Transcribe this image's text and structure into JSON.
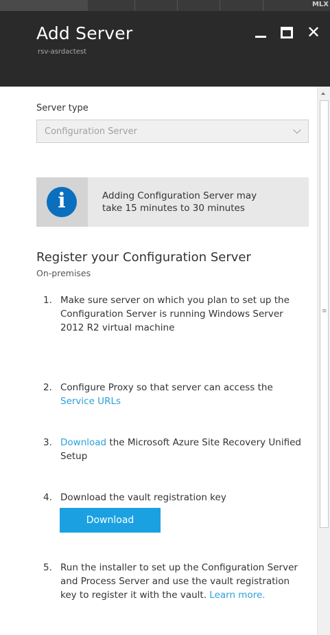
{
  "top_strip": {
    "right_text": "MLX"
  },
  "header": {
    "title": "Add Server",
    "subtitle": "rsv-asrdactest"
  },
  "form": {
    "server_type_label": "Server type",
    "server_type_value": "Configuration Server"
  },
  "info": {
    "message_line1": "Adding Configuration Server may",
    "message_line2": "take 15 minutes to 30 minutes"
  },
  "section": {
    "title": "Register your Configuration Server",
    "subtitle": "On-premises"
  },
  "steps": [
    {
      "num": "1.",
      "text": "Make sure server on which you plan to set up the Configuration Server is running Windows Server 2012 R2 virtual machine"
    },
    {
      "num": "2.",
      "text": "Configure Proxy so that server can access the ",
      "link": "Service URLs"
    },
    {
      "num": "3.",
      "link": "Download",
      "text": " the Microsoft Azure Site Recovery Unified Setup"
    },
    {
      "num": "4.",
      "text": "Download the vault registration key",
      "button": "Download"
    },
    {
      "num": "5.",
      "text": "Run the installer to set up the Configuration Server and Process Server and use the vault registration key to register it with the vault. ",
      "link": "Learn more."
    }
  ],
  "colors": {
    "header_bg": "#2a2a2a",
    "accent": "#1ba1e2",
    "link": "#2aa0da",
    "info_icon": "#0a6fbf"
  }
}
